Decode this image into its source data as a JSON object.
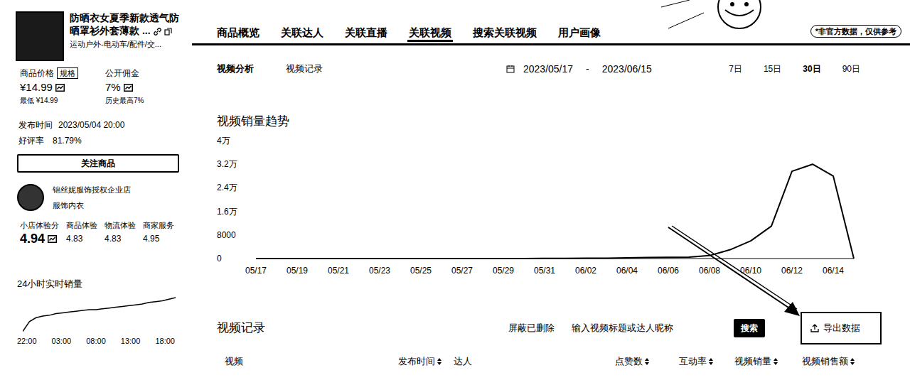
{
  "product": {
    "title": "防晒衣女夏季新款透气防晒罩衫外套薄款 ...",
    "category": "运动户外-电动车/配件/交...",
    "price_label": "商品价格",
    "spec_badge": "规格",
    "price": "¥14.99",
    "commission_label": "公开佣金",
    "commission": "7%",
    "lowest": "最低 ¥14.99",
    "history_high": "历史最高7%",
    "publish_label": "发布时间",
    "publish_time": "2023/05/04 20:00",
    "rating_label": "好评率",
    "rating": "81.79%",
    "follow_button": "关注商品"
  },
  "shop": {
    "name": "锦丝妮服饰授权企业店",
    "category": "服饰内衣",
    "scores": [
      {
        "label": "小店体验分",
        "value": "4.94"
      },
      {
        "label": "商品体验",
        "value": "4.83"
      },
      {
        "label": "物流体验",
        "value": "4.83"
      },
      {
        "label": "商家服务",
        "value": "4.95"
      }
    ]
  },
  "realtime": {
    "title": "24小时实时销量",
    "ticks": [
      "22:00",
      "03:00",
      "08:00",
      "13:00",
      "18:00"
    ],
    "values": [
      4,
      16,
      21,
      23,
      24,
      26,
      27,
      28,
      29,
      30,
      31,
      31,
      32,
      33,
      34,
      35,
      36,
      37,
      38,
      40,
      41,
      42,
      44,
      46
    ]
  },
  "tabs": [
    {
      "label": "商品概览",
      "selected": false
    },
    {
      "label": "关联达人",
      "selected": false
    },
    {
      "label": "关联直播",
      "selected": false
    },
    {
      "label": "关联视频",
      "selected": true
    },
    {
      "label": "搜索关联视频",
      "selected": false
    },
    {
      "label": "用户画像",
      "selected": false
    }
  ],
  "notice": "*非官方数据，仅供参考",
  "subtabs": [
    {
      "label": "视频分析",
      "selected": true
    },
    {
      "label": "视频记录",
      "selected": false
    }
  ],
  "date_range": {
    "start": "2023/05/17",
    "separator": "-",
    "end": "2023/06/15"
  },
  "periods": [
    {
      "label": "7日",
      "selected": false
    },
    {
      "label": "15日",
      "selected": false
    },
    {
      "label": "30日",
      "selected": true
    },
    {
      "label": "90日",
      "selected": false
    }
  ],
  "chart": {
    "title": "视频销量趋势",
    "y_ticks": [
      "4万",
      "3.2万",
      "2.4万",
      "1.6万",
      "8000",
      "0"
    ],
    "y_max": 40000,
    "x_ticks": [
      "05/17",
      "05/19",
      "05/21",
      "05/23",
      "05/25",
      "05/27",
      "05/29",
      "05/31",
      "06/02",
      "06/04",
      "06/06",
      "06/08",
      "06/10",
      "06/12",
      "06/14"
    ],
    "series": [
      {
        "values": [
          0,
          0,
          0,
          0,
          0,
          0,
          0,
          0,
          0,
          0,
          0,
          0,
          0,
          0,
          50,
          80,
          100,
          150,
          250,
          350,
          450,
          500,
          1000,
          3000,
          6000,
          11000,
          29600,
          32000,
          28000,
          0
        ]
      }
    ]
  },
  "records": {
    "title": "视频记录",
    "filter": "屏蔽已删除",
    "search_placeholder": "输入视频标题或达人昵称",
    "search_button": "搜索",
    "export_button": "导出数据",
    "columns": [
      {
        "label": "视频",
        "sortable": false
      },
      {
        "label": "发布时间",
        "sortable": true
      },
      {
        "label": "达人",
        "sortable": false
      },
      {
        "label": "点赞数",
        "sortable": true
      },
      {
        "label": "互动率",
        "sortable": true
      },
      {
        "label": "视频销量",
        "sortable": true
      },
      {
        "label": "视频销售额",
        "sortable": true
      }
    ]
  }
}
